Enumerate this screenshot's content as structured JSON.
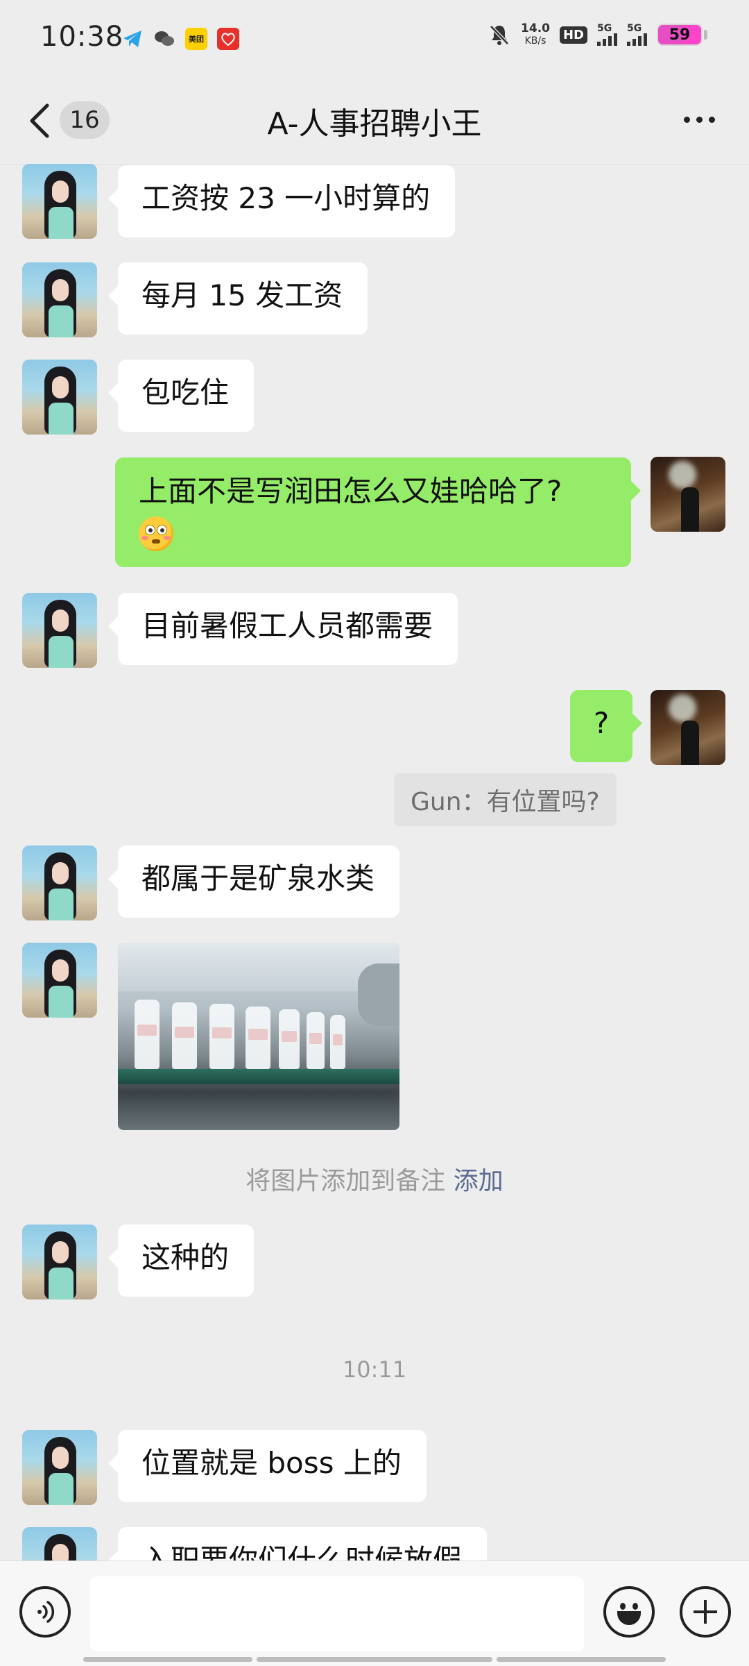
{
  "status_bar": {
    "time": "10:38",
    "icons": [
      "telegram-icon",
      "wechat-icon",
      "meituan-icon",
      "app-icon",
      "mute-icon"
    ],
    "meituan_label": "美团",
    "net_speed_value": "14.0",
    "net_speed_unit": "KB/s",
    "hd_label": "HD",
    "signal_1": "5G",
    "signal_2": "5G",
    "battery": "59",
    "battery_level": 0.59,
    "battery_color": "#e84ec3"
  },
  "header": {
    "unread_count": "16",
    "title": "A-人事招聘小王"
  },
  "messages": {
    "m1": "工资按 23 一小时算的",
    "m2": "每月 15 发工资",
    "m3": "包吃住",
    "m4": "上面不是写润田怎么又娃哈哈了?",
    "m5": "目前暑假工人员都需要",
    "m6": "?",
    "quote": "Gun：有位置吗?",
    "m7": "都属于是矿泉水类",
    "m8": "这种的",
    "m9": "位置就是 boss 上的",
    "m10": "入职要你们什么时候放假"
  },
  "system_note": {
    "text": "将图片添加到备注",
    "link": "添加"
  },
  "timestamp": "10:11",
  "colors": {
    "background": "#ededed",
    "sent_bubble": "#95ec69",
    "received_bubble": "#ffffff",
    "link": "#5a6b94"
  }
}
